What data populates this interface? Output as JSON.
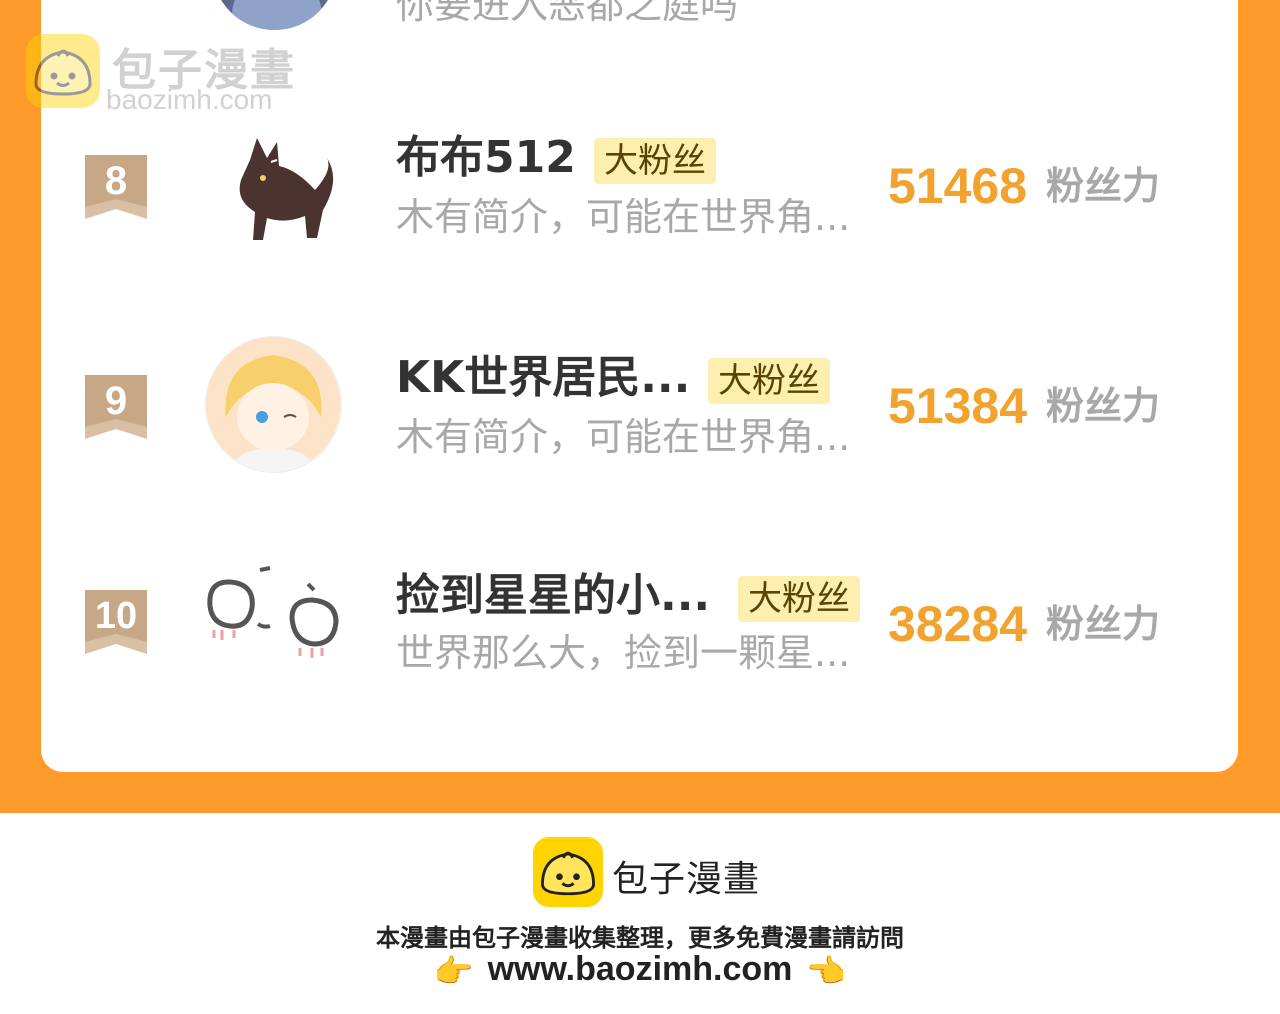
{
  "colors": {
    "frame": "#FF9B2B",
    "score": "#F2A22E",
    "badge_bg": "#FDEFB0",
    "logo": "#FFD400"
  },
  "prev_entry": {
    "desc_fragment": "你要进入恶都之庭吗"
  },
  "watermark": {
    "title": "包子漫畫",
    "url": "baozimh.com"
  },
  "rankings": [
    {
      "rank": "8",
      "name": "布布512",
      "badge": "大粉丝",
      "desc": "木有简介，可能在世界角...",
      "score": "51468",
      "unit": "粉丝力",
      "avatar_icon": "wolf-avatar-icon"
    },
    {
      "rank": "9",
      "name": "KK世界居民...",
      "badge": "大粉丝",
      "desc": "木有简介，可能在世界角...",
      "score": "51384",
      "unit": "粉丝力",
      "avatar_icon": "anime-boy-avatar-icon"
    },
    {
      "rank": "10",
      "name": "捡到星星的小...",
      "badge": "大粉丝",
      "desc": "世界那么大，捡到一颗星...",
      "score": "38284",
      "unit": "粉丝力",
      "avatar_icon": "doodle-faces-avatar-icon"
    }
  ],
  "footer": {
    "brand": "包子漫畫",
    "notice": "本漫畫由包子漫畫收集整理，更多免費漫畫請訪問",
    "url": "www.baozimh.com",
    "left_hand": "👉",
    "right_hand": "👈"
  }
}
